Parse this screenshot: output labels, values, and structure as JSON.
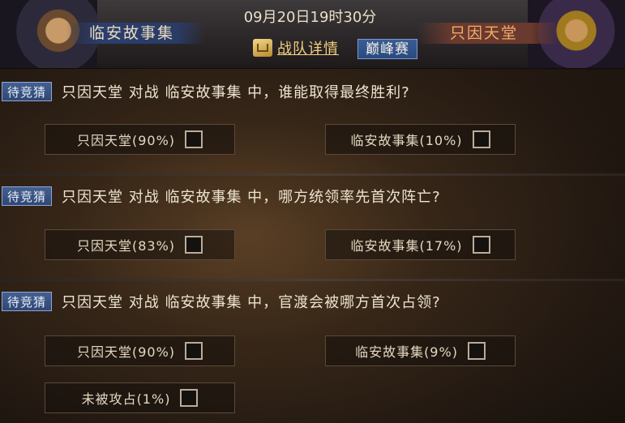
{
  "header": {
    "left_team": "临安故事集",
    "right_team": "只因天堂",
    "match_time": "09月20日19时30分",
    "team_detail_label": "战队详情",
    "stage_badge": "巅峰赛"
  },
  "questions": [
    {
      "status": "待竞猜",
      "text": "只因天堂 对战 临安故事集 中，谁能取得最终胜利?",
      "options": [
        "只因天堂(90%)",
        "临安故事集(10%)"
      ]
    },
    {
      "status": "待竞猜",
      "text": "只因天堂 对战 临安故事集 中，哪方统领率先首次阵亡?",
      "options": [
        "只因天堂(83%)",
        "临安故事集(17%)"
      ]
    },
    {
      "status": "待竞猜",
      "text": "只因天堂 对战 临安故事集 中，官渡会被哪方首次占领?",
      "options": [
        "只因天堂(90%)",
        "临安故事集(9%)",
        "未被攻占(1%)"
      ]
    }
  ]
}
